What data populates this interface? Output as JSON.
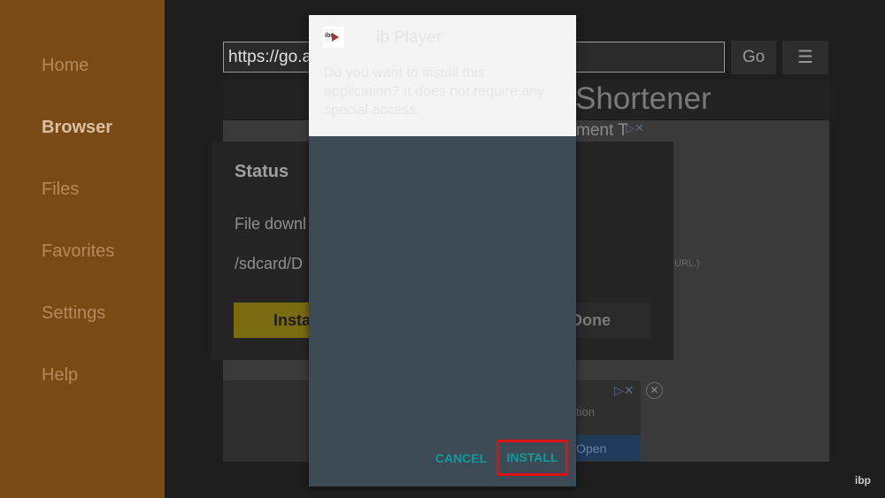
{
  "sidebar": {
    "items": [
      {
        "label": "Home"
      },
      {
        "label": "Browser"
      },
      {
        "label": "Files"
      },
      {
        "label": "Favorites"
      },
      {
        "label": "Settings"
      },
      {
        "label": "Help"
      }
    ]
  },
  "browser": {
    "url": "https://go.a",
    "go_label": "Go",
    "menu_glyph": "☰",
    "site_title": "Shortener",
    "ad_text_1": "ment T",
    "ad_icons": "▷✕",
    "url_note": "URL.)",
    "ad_option": "tion",
    "open_label": "Open",
    "close_glyph": "✕"
  },
  "status_dialog": {
    "title": "Status",
    "file_line": "File downl",
    "path_line": "/sdcard/D",
    "install_label": "Insta",
    "done_label": "Done"
  },
  "install_dialog": {
    "app_name": "ib Player",
    "prompt": "Do you want to install this application? It does not require any special access.",
    "cancel_label": "CANCEL",
    "install_label": "INSTALL",
    "icon_text": "ibo"
  },
  "watermark": "ibp"
}
